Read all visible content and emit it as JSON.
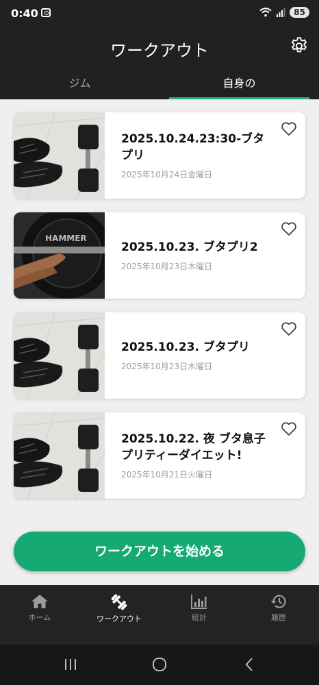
{
  "status_bar": {
    "time": "0:40",
    "battery": "85"
  },
  "header": {
    "title": "ワークアウト"
  },
  "tabs": [
    {
      "label": "ジム",
      "active": false
    },
    {
      "label": "自身の",
      "active": true
    }
  ],
  "workouts": [
    {
      "title": "2025.10.24.23:30-ブタプリ",
      "date": "2025年10月24日金曜日",
      "image": "dumbbell-and-sneakers"
    },
    {
      "title": "2025.10.23. ブタプリ2",
      "date": "2025年10月23日木曜日",
      "image": "barbell-plate"
    },
    {
      "title": "2025.10.23. ブタプリ",
      "date": "2025年10月23日木曜日",
      "image": "dumbbell-and-sneakers"
    },
    {
      "title": "2025.10.22. 夜 ブタ息子プリティーダイエット!",
      "date": "2025年10月21日火曜日",
      "image": "dumbbell-and-sneakers"
    }
  ],
  "start_button": {
    "label": "ワークアウトを始める"
  },
  "bottom_nav": [
    {
      "label": "ホーム",
      "icon": "home-icon",
      "active": false
    },
    {
      "label": "ワークアウト",
      "icon": "dumbbell-icon",
      "active": true
    },
    {
      "label": "統計",
      "icon": "bar-chart-icon",
      "active": false
    },
    {
      "label": "履歴",
      "icon": "history-icon",
      "active": false
    }
  ],
  "colors": {
    "accent": "#17a974",
    "header_bg": "#212121",
    "page_bg": "#efefef"
  }
}
